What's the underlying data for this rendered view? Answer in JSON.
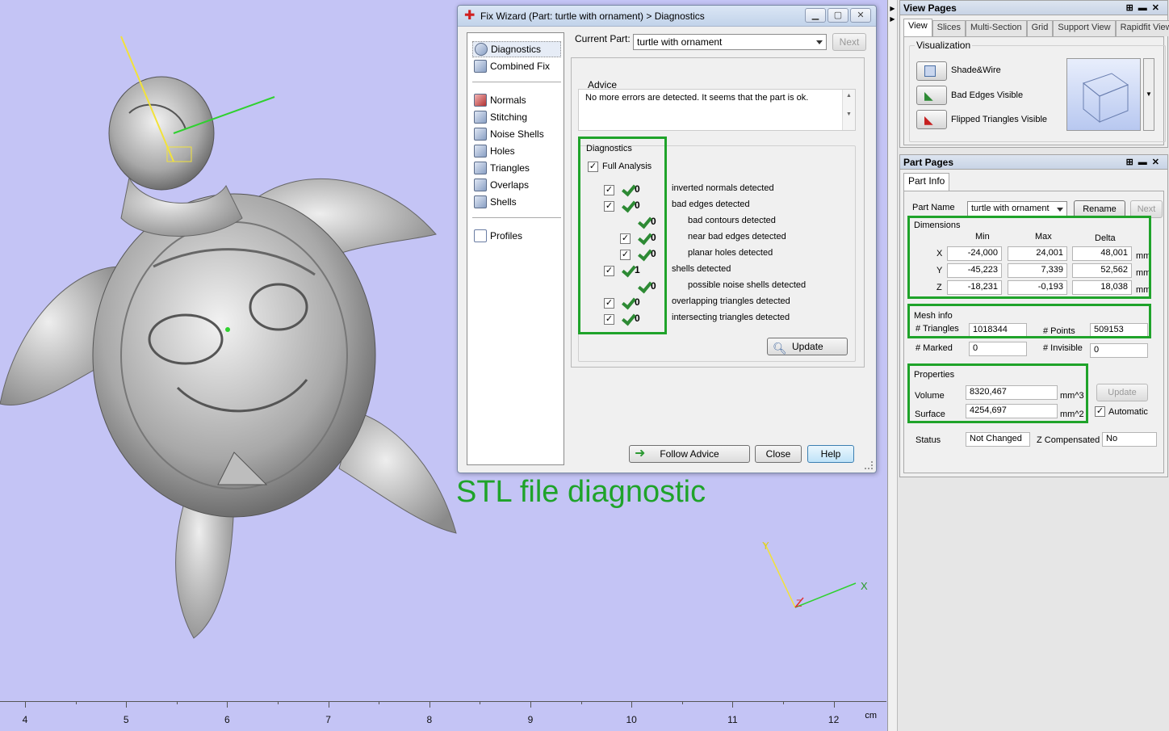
{
  "viewport": {
    "caption": "STL file diagnostic",
    "ruler": {
      "labels": [
        "4",
        "5",
        "6",
        "7",
        "8",
        "9",
        "10",
        "11",
        "12"
      ],
      "unit": "cm"
    },
    "axes": {
      "x": "X",
      "y": "Y",
      "z": "Z"
    }
  },
  "dialog": {
    "title": "Fix Wizard (Part: turtle with ornament) > Diagnostics",
    "nav": {
      "items_top": [
        {
          "label": "Diagnostics",
          "icon": "magnifier-icon"
        },
        {
          "label": "Combined Fix",
          "icon": "cube-icon"
        }
      ],
      "items_mid": [
        {
          "label": "Normals",
          "icon": "normals-icon"
        },
        {
          "label": "Stitching",
          "icon": "stitching-icon"
        },
        {
          "label": "Noise Shells",
          "icon": "noise-shells-icon"
        },
        {
          "label": "Holes",
          "icon": "holes-icon"
        },
        {
          "label": "Triangles",
          "icon": "triangles-icon"
        },
        {
          "label": "Overlaps",
          "icon": "overlaps-icon"
        },
        {
          "label": "Shells",
          "icon": "shells-icon"
        }
      ],
      "items_bottom": [
        {
          "label": "Profiles",
          "icon": "document-icon"
        }
      ]
    },
    "current_part_label": "Current Part:",
    "current_part_value": "turtle with ornament",
    "next_label": "Next",
    "advice_title": "Advice",
    "advice_text": "No more errors are detected. It seems that the part is ok.",
    "diagnostics_title": "Diagnostics",
    "full_analysis": "Full Analysis",
    "rows": [
      {
        "checkbox": true,
        "count": "0",
        "label": "inverted normals detected",
        "indent": false
      },
      {
        "checkbox": true,
        "count": "0",
        "label": "bad edges detected",
        "indent": false
      },
      {
        "checkbox": false,
        "count": "0",
        "label": "bad contours detected",
        "indent": true
      },
      {
        "checkbox": true,
        "count": "0",
        "label": "near bad edges detected",
        "indent": true
      },
      {
        "checkbox": true,
        "count": "0",
        "label": "planar holes detected",
        "indent": true
      },
      {
        "checkbox": true,
        "count": "1",
        "label": "shells detected",
        "indent": false
      },
      {
        "checkbox": false,
        "count": "0",
        "label": "possible noise shells detected",
        "indent": true
      },
      {
        "checkbox": true,
        "count": "0",
        "label": "overlapping triangles detected",
        "indent": false
      },
      {
        "checkbox": true,
        "count": "0",
        "label": "intersecting triangles detected",
        "indent": false
      }
    ],
    "update_label": "Update",
    "follow_advice_label": "Follow Advice",
    "close_label": "Close",
    "help_label": "Help"
  },
  "view_pages": {
    "title": "View Pages",
    "tabs": [
      "View",
      "Slices",
      "Multi-Section",
      "Grid",
      "Support View",
      "Rapidfit View"
    ],
    "visualization_title": "Visualization",
    "options": [
      "Shade&Wire",
      "Bad Edges Visible",
      "Flipped Triangles Visible"
    ]
  },
  "part_pages": {
    "title": "Part Pages",
    "tab": "Part Info",
    "part_name_label": "Part Name",
    "part_name_value": "turtle with ornament",
    "rename_label": "Rename",
    "next_label": "Next",
    "dimensions": {
      "title": "Dimensions",
      "headers": [
        "Min",
        "Max",
        "Delta"
      ],
      "rows": [
        {
          "axis": "X",
          "min": "-24,000",
          "max": "24,001",
          "delta": "48,001",
          "unit": "mm"
        },
        {
          "axis": "Y",
          "min": "-45,223",
          "max": "7,339",
          "delta": "52,562",
          "unit": "mm"
        },
        {
          "axis": "Z",
          "min": "-18,231",
          "max": "-0,193",
          "delta": "18,038",
          "unit": "mm"
        }
      ]
    },
    "mesh_info": {
      "title": "Mesh info",
      "triangles_label": "# Triangles",
      "triangles_value": "1018344",
      "points_label": "# Points",
      "points_value": "509153",
      "marked_label": "# Marked",
      "marked_value": "0",
      "invisible_label": "# Invisible",
      "invisible_value": "0"
    },
    "properties": {
      "title": "Properties",
      "volume_label": "Volume",
      "volume_value": "8320,467",
      "volume_unit": "mm^3",
      "surface_label": "Surface",
      "surface_value": "4254,697",
      "surface_unit": "mm^2",
      "update_label": "Update",
      "automatic_label": "Automatic"
    },
    "status_label": "Status",
    "status_value": "Not Changed",
    "z_comp_label": "Z Compensated",
    "z_comp_value": "No"
  },
  "colors": {
    "highlight": "#1fa32a",
    "viewport_bg": "#c4c4f5",
    "check_green": "#2d8a34"
  }
}
